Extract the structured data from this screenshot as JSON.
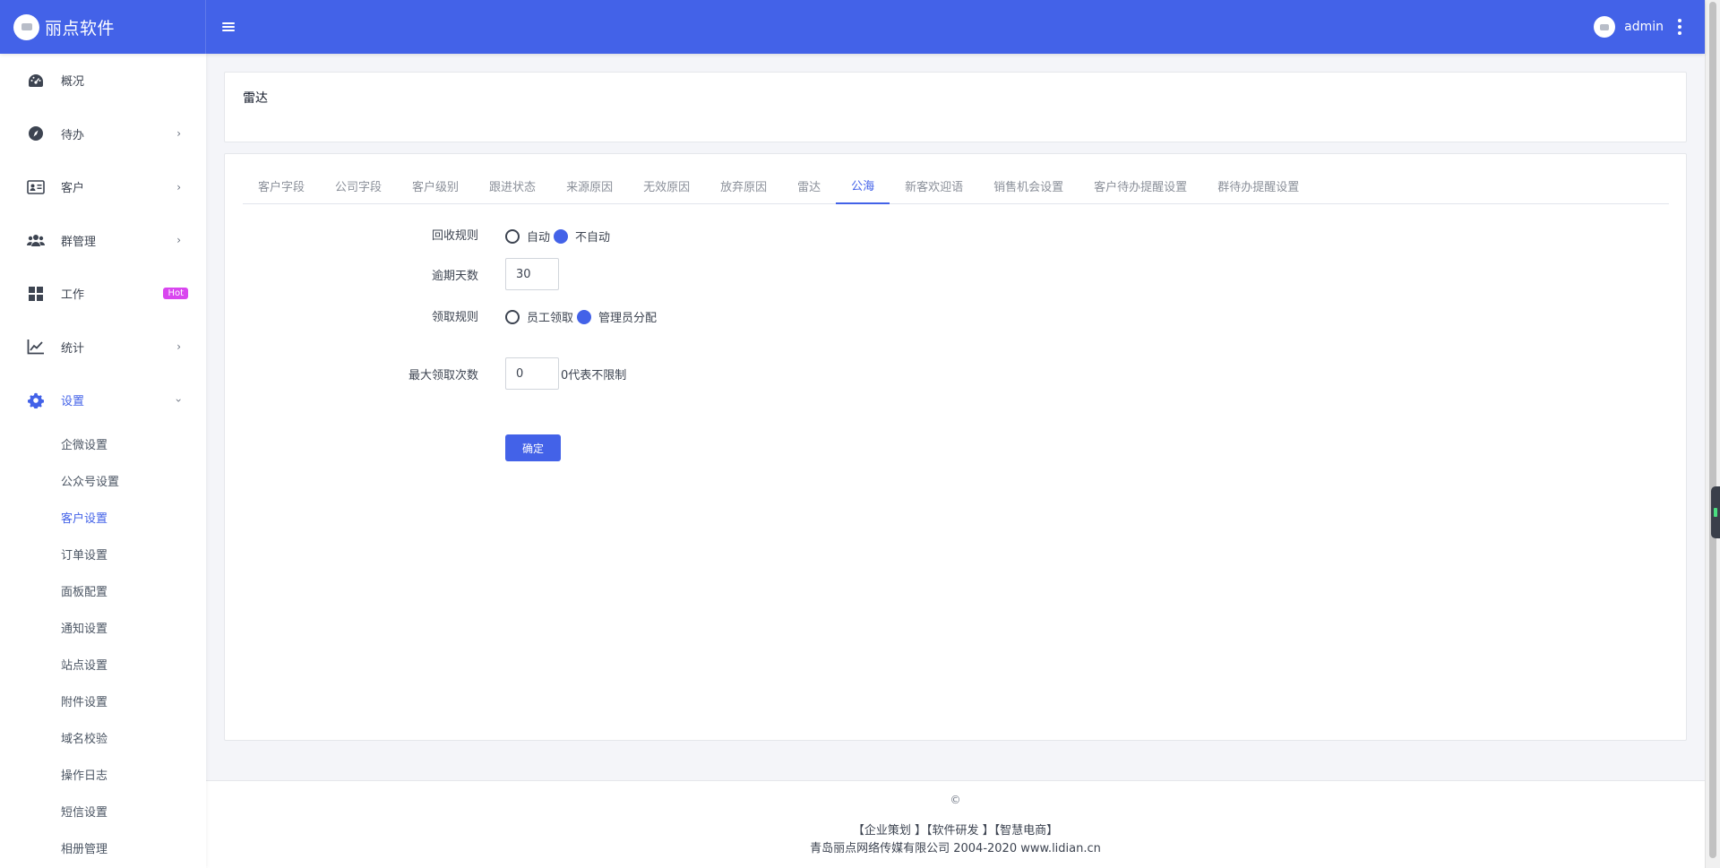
{
  "brand": {
    "name": "丽点软件"
  },
  "user": {
    "name": "admin"
  },
  "colors": {
    "primary": "#4362e8",
    "hot_badge": "#d946ef"
  },
  "sidebar": {
    "items": [
      {
        "label": "概况",
        "icon": "dashboard-icon"
      },
      {
        "label": "待办",
        "icon": "compass-icon"
      },
      {
        "label": "客户",
        "icon": "id-card-icon"
      },
      {
        "label": "群管理",
        "icon": "users-icon"
      },
      {
        "label": "工作",
        "icon": "grid-icon",
        "badge": "Hot"
      },
      {
        "label": "统计",
        "icon": "line-chart-icon"
      },
      {
        "label": "设置",
        "icon": "gear-icon"
      }
    ],
    "sub_items": [
      "企微设置",
      "公众号设置",
      "客户设置",
      "订单设置",
      "面板配置",
      "通知设置",
      "站点设置",
      "附件设置",
      "域名校验",
      "操作日志",
      "短信设置",
      "相册管理"
    ]
  },
  "card": {
    "title": "雷达"
  },
  "tabs": [
    "客户字段",
    "公司字段",
    "客户级别",
    "跟进状态",
    "来源原因",
    "无效原因",
    "放弃原因",
    "雷达",
    "公海",
    "新客欢迎语",
    "销售机会设置",
    "客户待办提醒设置",
    "群待办提醒设置"
  ],
  "form": {
    "recycle": {
      "label": "回收规则",
      "options": [
        "自动",
        "不自动"
      ],
      "selected": "不自动"
    },
    "overdue": {
      "label": "逾期天数",
      "value": "30"
    },
    "claim": {
      "label": "领取规则",
      "options": [
        "员工领取",
        "管理员分配"
      ],
      "selected": "管理员分配"
    },
    "max_claim": {
      "label": "最大领取次数",
      "value": "0",
      "hint": "0代表不限制"
    },
    "submit": "确定"
  },
  "footer": {
    "copy": "©",
    "links": "【企业策划 】【软件研发 】【智慧电商】",
    "company": "青岛丽点网络传媒有限公司 2004-2020 www.lidian.cn"
  }
}
